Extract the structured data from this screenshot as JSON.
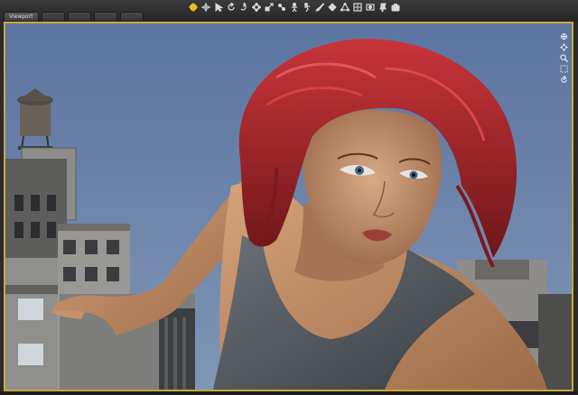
{
  "viewport_tabs": [
    {
      "label": "Viewport",
      "active": true
    },
    {
      "label": "",
      "active": false
    },
    {
      "label": "",
      "active": false
    },
    {
      "label": "",
      "active": false
    },
    {
      "label": "",
      "active": false
    }
  ],
  "toolbar": {
    "tools": [
      {
        "name": "universal-tool-icon",
        "active": true
      },
      {
        "name": "node-selection-icon",
        "active": false
      },
      {
        "name": "pointer-icon",
        "active": false
      },
      {
        "name": "rotate-icon",
        "active": false
      },
      {
        "name": "twist-icon",
        "active": false
      },
      {
        "name": "translate-icon",
        "active": false
      },
      {
        "name": "scale-icon",
        "active": false
      },
      {
        "name": "joint-editor-icon",
        "active": false
      },
      {
        "name": "figure-icon",
        "active": false
      },
      {
        "name": "active-pose-icon",
        "active": false
      },
      {
        "name": "brush-icon",
        "active": false
      },
      {
        "name": "surface-selection-icon",
        "active": false
      },
      {
        "name": "geometry-editor-icon",
        "active": false
      },
      {
        "name": "region-navigator-icon",
        "active": false
      },
      {
        "name": "spot-render-icon",
        "active": false
      },
      {
        "name": "camera-pin-icon",
        "active": false
      },
      {
        "name": "camera-icon",
        "active": false
      }
    ]
  },
  "nav_controls": [
    "orbit-icon",
    "pan-icon",
    "zoom-icon",
    "frame-icon",
    "reset-view-icon"
  ],
  "colors": {
    "frame_accent": "#c9a93a",
    "sky": "#6f88ad",
    "hair": "#b0282a"
  }
}
